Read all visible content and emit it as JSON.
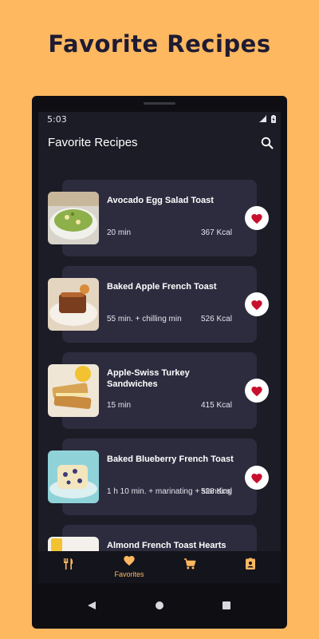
{
  "headline": "Favorite Recipes",
  "status": {
    "time": "5:03"
  },
  "appbar": {
    "title": "Favorite Recipes"
  },
  "recipes": [
    {
      "name": "Avocado Egg Salad Toast",
      "time": "20 min",
      "kcal": "367 Kcal"
    },
    {
      "name": "Baked Apple French Toast",
      "time": "55 min. + chilling min",
      "kcal": "526 Kcal"
    },
    {
      "name": "Apple-Swiss Turkey Sandwiches",
      "time": "15 min",
      "kcal": "415 Kcal"
    },
    {
      "name": "Baked Blueberry French Toast",
      "time": "1 h 10 min. + marinating + standing",
      "kcal": "528 Kcal"
    },
    {
      "name": "Almond French Toast Hearts",
      "time": "",
      "kcal": ""
    }
  ],
  "nav": {
    "favorites_label": "Favorites"
  },
  "colors": {
    "accent": "#FDB860",
    "heart": "#C8102E",
    "card": "#2D2C3F",
    "screen": "#1C1C27"
  }
}
